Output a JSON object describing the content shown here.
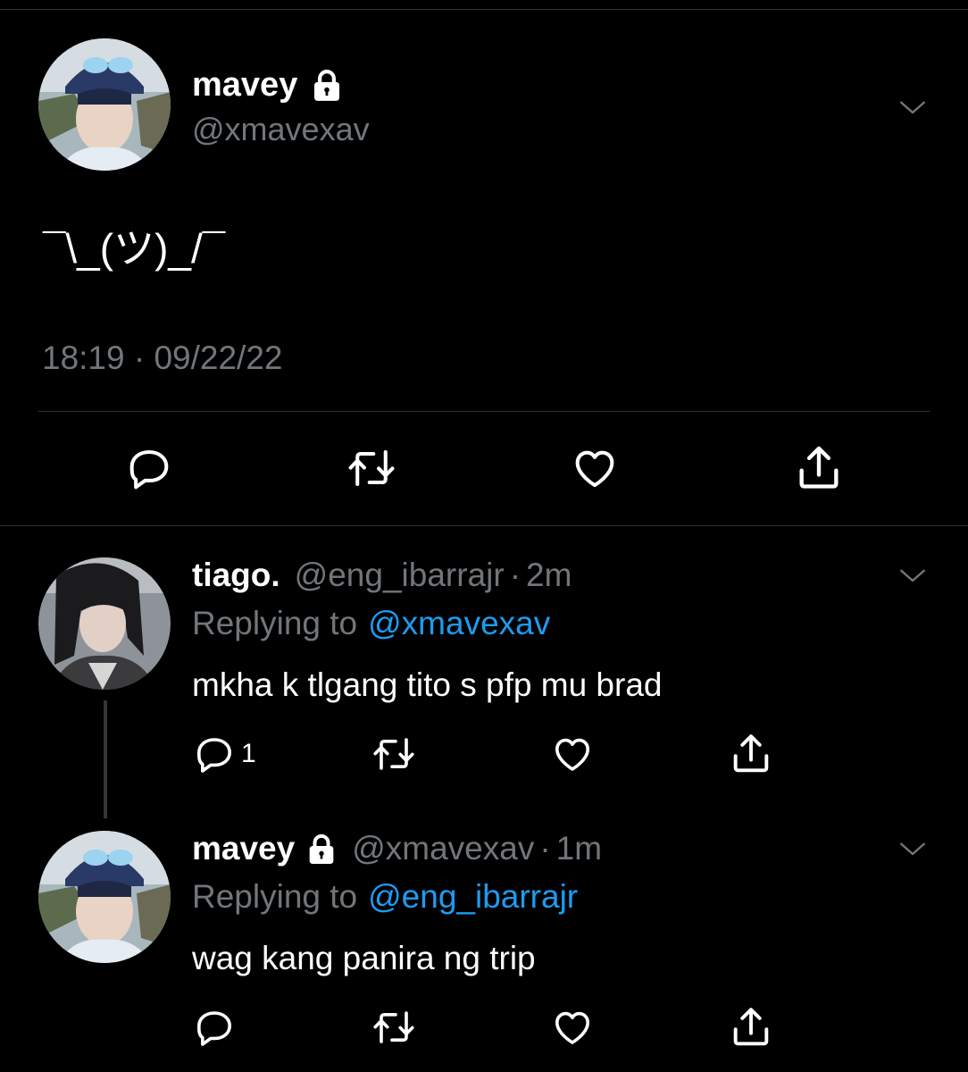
{
  "main_tweet": {
    "display_name": "mavey",
    "handle": "@xmavexav",
    "text": "¯\\_(ツ)_/¯",
    "timestamp": "18:19 · 09/22/22",
    "locked": true
  },
  "replies": [
    {
      "display_name": "tiago.",
      "handle": "@eng_ibarrajr",
      "sep": "·",
      "time": "2m",
      "replying_prefix": "Replying to",
      "replying_to": "@xmavexav",
      "text": "mkha k tlgang tito s pfp mu brad",
      "reply_count": "1",
      "locked": false
    },
    {
      "display_name": "mavey",
      "handle": "@xmavexav",
      "sep": "·",
      "time": "1m",
      "replying_prefix": "Replying to",
      "replying_to": "@eng_ibarrajr",
      "text": "wag kang panira ng trip",
      "reply_count": "",
      "locked": true
    }
  ],
  "colors": {
    "background": "#000000",
    "accent": "#1d9bf0",
    "muted": "#71767b",
    "divider": "#2f3336"
  },
  "icons": [
    "reply-icon",
    "retweet-icon",
    "like-icon",
    "share-icon",
    "lock-icon",
    "chevron-down-icon"
  ]
}
